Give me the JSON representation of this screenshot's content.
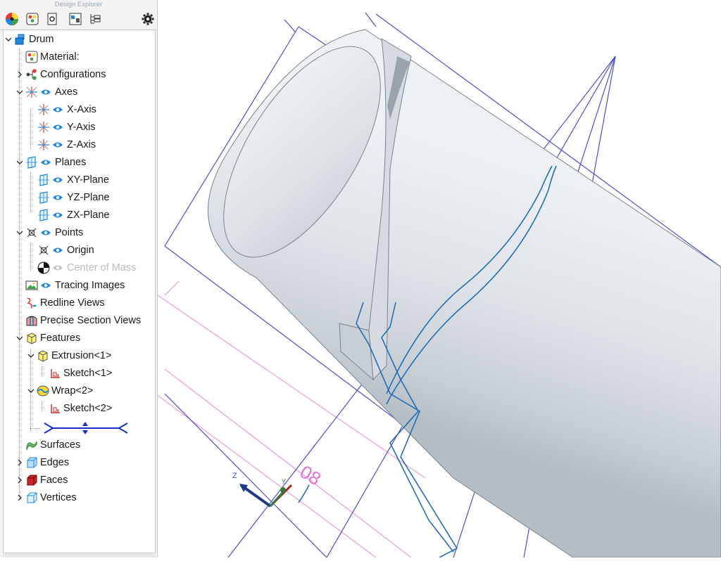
{
  "panel": {
    "title": "Design Explorer"
  },
  "tree": {
    "root": "Drum",
    "material": "Material:",
    "configurations": "Configurations",
    "axes": "Axes",
    "x_axis": "X-Axis",
    "y_axis": "Y-Axis",
    "z_axis": "Z-Axis",
    "planes": "Planes",
    "xy_plane": "XY-Plane",
    "yz_plane": "YZ-Plane",
    "zx_plane": "ZX-Plane",
    "points": "Points",
    "origin": "Origin",
    "center_of_mass": "Center of Mass",
    "tracing_images": "Tracing Images",
    "redline_views": "Redline Views",
    "precise_section_views": "Precise Section Views",
    "features": "Features",
    "extrusion": "Extrusion<1>",
    "sketch1": "Sketch<1>",
    "wrap": "Wrap<2>",
    "sketch2": "Sketch<2>",
    "surfaces": "Surfaces",
    "edges": "Edges",
    "faces": "Faces",
    "vertices": "Vertices"
  },
  "viewport": {
    "dimension_label": "08",
    "triad_z": "Z",
    "triad_y": "Y"
  },
  "colors": {
    "sketch_blue": "#1f6fb8",
    "frame_blue": "#4b4ed1",
    "dimension_pink": "#e66fd6",
    "eye_blue": "#1e88e5"
  }
}
